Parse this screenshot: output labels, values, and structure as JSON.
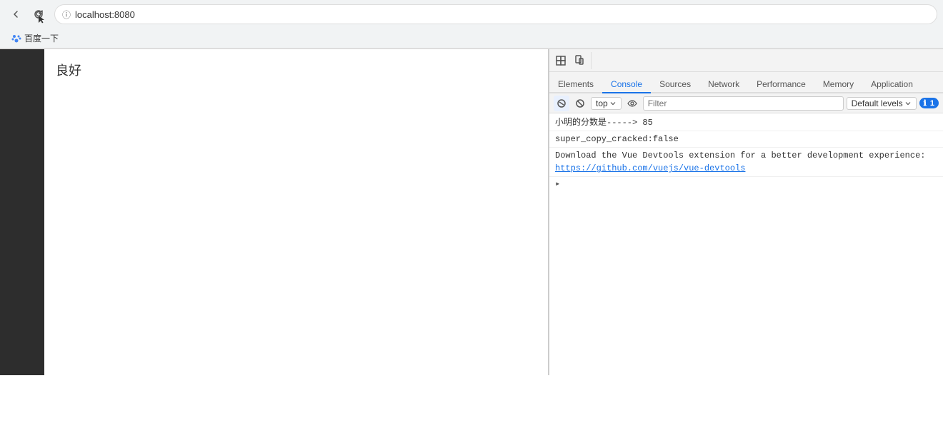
{
  "browser": {
    "url": "localhost:8080",
    "back_title": "Back",
    "refresh_title": "Refresh"
  },
  "bookmarks": {
    "items": [
      {
        "label": "百度一下",
        "favicon_color": "#4285f4"
      }
    ]
  },
  "page": {
    "content": "良好"
  },
  "devtools": {
    "tabs": [
      {
        "label": "Elements",
        "active": false
      },
      {
        "label": "Console",
        "active": true
      },
      {
        "label": "Sources",
        "active": false
      },
      {
        "label": "Network",
        "active": false
      },
      {
        "label": "Performance",
        "active": false
      },
      {
        "label": "Memory",
        "active": false
      },
      {
        "label": "Application",
        "active": false
      }
    ],
    "console": {
      "context": "top",
      "filter_placeholder": "Filter",
      "default_levels": "Default levels",
      "badge_count": "1",
      "output_lines": [
        {
          "type": "log",
          "text": "小明的分数是----->  85",
          "color": "#333"
        },
        {
          "type": "log",
          "text": "super_copy_cracked:false",
          "color": "#333"
        },
        {
          "type": "info",
          "text": "Download the Vue Devtools extension for a better development experience:",
          "color": "#333"
        },
        {
          "type": "link",
          "text": "https://github.com/vuejs/vue-devtools",
          "color": "#1a73e8"
        }
      ],
      "prompt_symbol": ">"
    }
  }
}
